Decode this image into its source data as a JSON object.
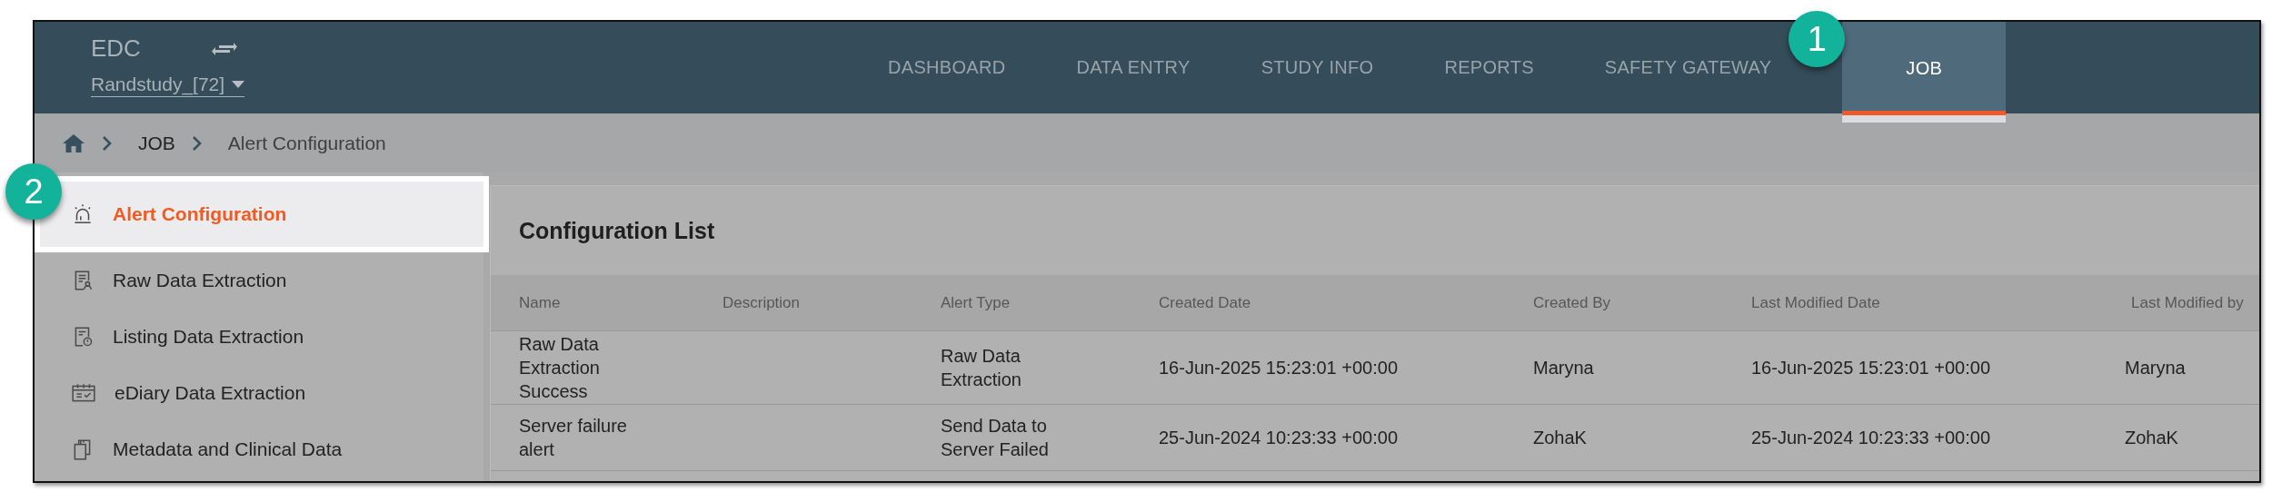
{
  "header": {
    "app_title": "EDC",
    "study_selector": "Randstudy_[72]",
    "nav": [
      {
        "label": "DASHBOARD",
        "selected": false
      },
      {
        "label": "DATA ENTRY",
        "selected": false
      },
      {
        "label": "STUDY INFO",
        "selected": false
      },
      {
        "label": "REPORTS",
        "selected": false
      },
      {
        "label": "SAFETY GATEWAY",
        "selected": false
      },
      {
        "label": "JOB",
        "selected": true,
        "callout": "1"
      }
    ]
  },
  "breadcrumb": [
    "JOB",
    "Alert Configuration"
  ],
  "sidebar": {
    "items": [
      {
        "label": "Alert Configuration",
        "selected": true,
        "callout": "2"
      },
      {
        "label": "Raw Data Extraction",
        "selected": false
      },
      {
        "label": "Listing Data Extraction",
        "selected": false
      },
      {
        "label": "eDiary Data Extraction",
        "selected": false
      },
      {
        "label": "Metadata and Clinical Data",
        "selected": false
      }
    ]
  },
  "panel": {
    "title": "Configuration List",
    "columns": [
      "Name",
      "Description",
      "Alert Type",
      "Created Date",
      "Created By",
      "Last Modified Date",
      "Last Modified by"
    ],
    "rows": [
      [
        "Raw Data Extraction Success",
        "",
        "Raw Data Extraction",
        "16-Jun-2025 15:23:01 +00:00",
        "Maryna",
        "16-Jun-2025 15:23:01 +00:00",
        "Maryna"
      ],
      [
        "Server failure alert",
        "",
        "Send Data to Server Failed",
        "25-Jun-2024 10:23:33 +00:00",
        "ZohaK",
        "25-Jun-2024 10:23:33 +00:00",
        "ZohaK"
      ]
    ]
  }
}
